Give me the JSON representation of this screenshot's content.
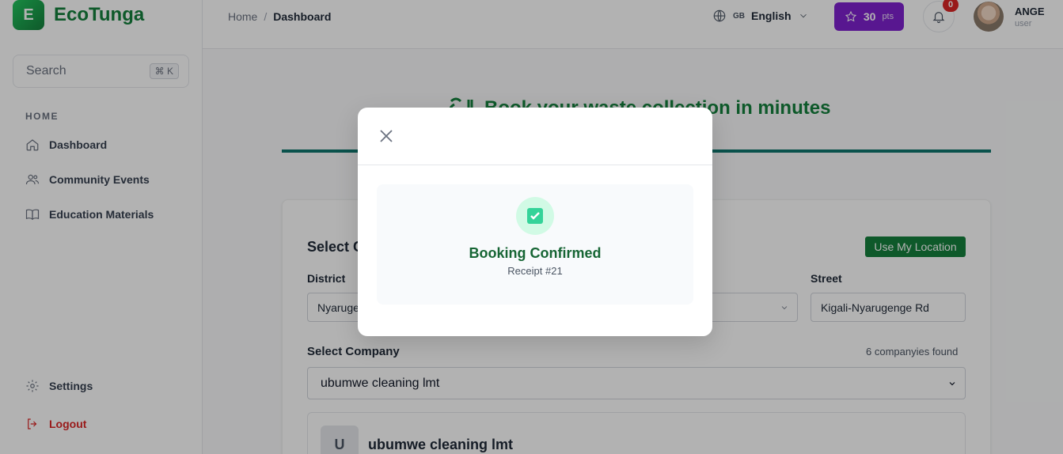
{
  "brand": {
    "logo_letter": "E",
    "name": "EcoTunga"
  },
  "search": {
    "placeholder": "Search",
    "shortcut": "⌘ K"
  },
  "sidebar": {
    "heading": "HOME",
    "items": [
      {
        "label": "Dashboard",
        "icon": "home-icon"
      },
      {
        "label": "Community Events",
        "icon": "users-icon"
      },
      {
        "label": "Education Materials",
        "icon": "book-icon"
      }
    ],
    "settings_label": "Settings",
    "logout_label": "Logout"
  },
  "header": {
    "breadcrumb": {
      "home": "Home",
      "separator": "/",
      "current": "Dashboard"
    },
    "language": {
      "code": "GB",
      "name": "English"
    },
    "points": {
      "value": "30",
      "unit": "pts"
    },
    "notifications_count": "0",
    "user": {
      "name": "ANGE",
      "role": "user"
    }
  },
  "main": {
    "hero_title": "Book your waste collection in minutes",
    "select_location_title": "Select C",
    "use_location_label": "Use My Location",
    "district_label": "District",
    "district_value": "Nyaruge",
    "street_label": "Street",
    "street_value": "Kigali-Nyarugenge Rd",
    "select_company_label": "Select Company",
    "companies_found": "6 companyies found",
    "company_selected": "ubumwe cleaning lmt",
    "company_card": {
      "initial": "U",
      "name": "ubumwe cleaning lmt"
    }
  },
  "modal": {
    "title": "Booking Confirmed",
    "receipt": "Receipt #21"
  },
  "colors": {
    "brand_green": "#15803d",
    "points_purple": "#7e22ce",
    "danger": "#dc2626"
  }
}
